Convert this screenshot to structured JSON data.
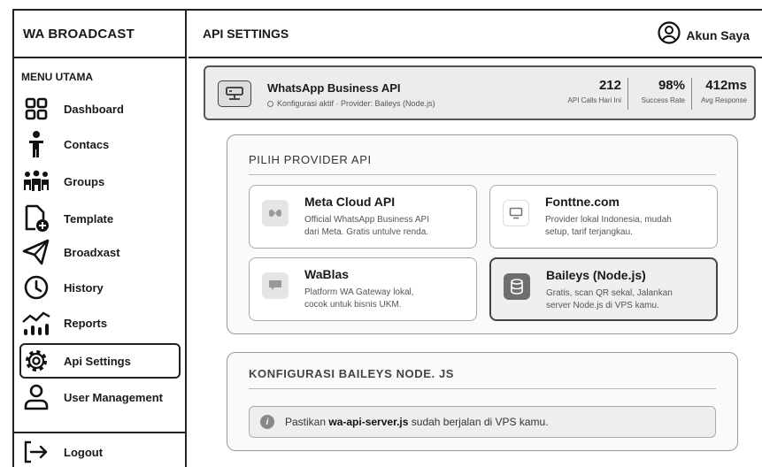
{
  "app": {
    "brand": "WA BROADCAST"
  },
  "sidebar": {
    "section_title": "MENU UTAMA",
    "items": [
      {
        "label": "Dashboard",
        "icon": "grid-icon"
      },
      {
        "label": "Contacs",
        "icon": "person-icon"
      },
      {
        "label": "Groups",
        "icon": "group-icon"
      },
      {
        "label": "Template",
        "icon": "add-file-icon"
      },
      {
        "label": "Broadxast",
        "icon": "send-icon"
      },
      {
        "label": "History",
        "icon": "clock-icon"
      },
      {
        "label": "Reports",
        "icon": "chart-icon"
      },
      {
        "label": "Api Settings",
        "icon": "gear-icon",
        "active": true
      },
      {
        "label": "User Management",
        "icon": "user-icon"
      }
    ],
    "logout_label": "Logout"
  },
  "header": {
    "title": "API SETTINGS",
    "account_label": "Akun Saya"
  },
  "status": {
    "title": "WhatsApp Business API",
    "subtitle": "Konfigurasi aktif · Provider: Baileys (Node.js)",
    "stats": [
      {
        "value": "212",
        "label": "API Calls Hari Ini"
      },
      {
        "value": "98%",
        "label": "Success Rate"
      },
      {
        "value": "412ms",
        "label": "Avg Response"
      }
    ]
  },
  "providers": {
    "section_title": "PILIH PROVIDER API",
    "items": [
      {
        "name": "Meta Cloud API",
        "desc_line1": "Official WhatsApp Business API",
        "desc_line2": "dari Meta. Gratis untulve renda.",
        "selected": false
      },
      {
        "name": "Fonttne.com",
        "desc_line1": "Provider lokal Indonesia, mudah",
        "desc_line2": "setup, tarif terjangkau.",
        "selected": false
      },
      {
        "name": "WaBlas",
        "desc_line1": "Platform WA Gateway lokal,",
        "desc_line2": "cocok untuk bisnis UKM.",
        "selected": false
      },
      {
        "name": "Baileys (Node.js)",
        "desc_line1": "Gratis, scan QR sekal, Jalankan",
        "desc_line2": "server Node.js di VPS kamu.",
        "selected": true
      }
    ]
  },
  "config": {
    "section_title": "KONFIGURASI BAILEYS NODE. JS",
    "notice_prefix": "Pastikan",
    "notice_file": "wa-api-server.js",
    "notice_suffix": "sudah berjalan di VPS kamu."
  }
}
